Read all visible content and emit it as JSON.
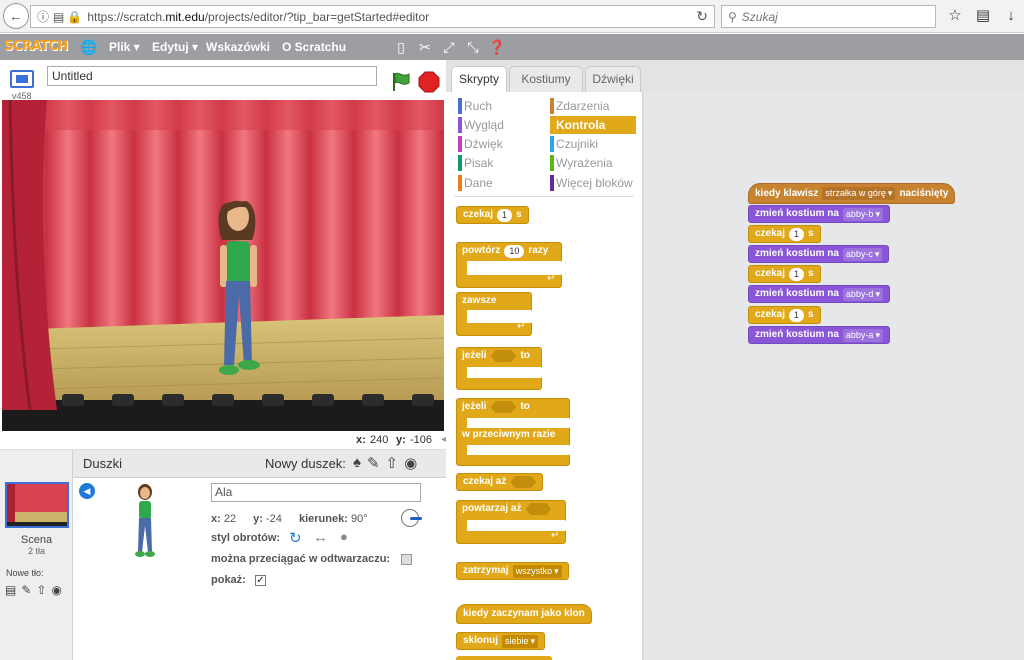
{
  "browser": {
    "url_prefix": "https://scratch.",
    "url_domain": "mit.edu",
    "url_suffix": "/projects/editor/?tip_bar=getStarted#editor",
    "search_placeholder": "Szukaj"
  },
  "menu": {
    "logo": "SCRATCH",
    "items": [
      "Plik ▾",
      "Edytuj ▾",
      "Wskazówki",
      "O Scratchu"
    ]
  },
  "stage": {
    "version": "v458",
    "title": "Untitled",
    "x_label": "x:",
    "x_value": "240",
    "y_label": "y:",
    "y_value": "-106"
  },
  "sprites": {
    "header": "Duszki",
    "new_sprite": "Nowy duszek:",
    "scene_label": "Scena",
    "scene_backdrops": "2 tła",
    "new_backdrop": "Nowe tło:",
    "sprite_name": "Ala",
    "x_label": "x:",
    "x_value": "22",
    "y_label": "y:",
    "y_value": "-24",
    "direction_label": "kierunek:",
    "direction_value": "90°",
    "rotation_label": "styl obrotów:",
    "draggable_label": "można przeciągać w odtwarzaczu:",
    "show_label": "pokaż:"
  },
  "tabs": [
    "Skrypty",
    "Kostiumy",
    "Dźwięki"
  ],
  "categories": [
    {
      "label": "Ruch",
      "color": "#4a6cd4"
    },
    {
      "label": "Wygląd",
      "color": "#8a55d7"
    },
    {
      "label": "Dźwięk",
      "color": "#bb42c3"
    },
    {
      "label": "Pisak",
      "color": "#0e9a6c"
    },
    {
      "label": "Dane",
      "color": "#ee7d16"
    },
    {
      "label": "Zdarzenia",
      "color": "#c88330"
    },
    {
      "label": "Kontrola",
      "color": "#e1a91a"
    },
    {
      "label": "Czujniki",
      "color": "#2ca5e2"
    },
    {
      "label": "Wyrażenia",
      "color": "#5cb712"
    },
    {
      "label": "Więcej bloków",
      "color": "#632d99"
    }
  ],
  "palette": {
    "wait": "czekaj",
    "wait_num": "1",
    "s": "s",
    "repeat": "powtórz",
    "repeat_num": "10",
    "times": "razy",
    "forever": "zawsze",
    "if": "jeżeli",
    "then": "to",
    "else": "w przeciwnym razie",
    "wait_until": "czekaj aż",
    "repeat_until": "powtarzaj aż",
    "stop": "zatrzymaj",
    "stop_opt": "wszystko",
    "clone_start": "kiedy zaczynam jako klon",
    "clone": "sklonuj",
    "clone_opt": "siebie"
  },
  "script": {
    "hat_pre": "kiedy klawisz",
    "hat_key": "strzałka w górę",
    "hat_post": "naciśnięty",
    "switch": "zmień kostium na",
    "wait": "czekaj",
    "one": "1",
    "s": "s",
    "costumes": [
      "abby-b",
      "abby-c",
      "abby-d",
      "abby-a"
    ]
  }
}
